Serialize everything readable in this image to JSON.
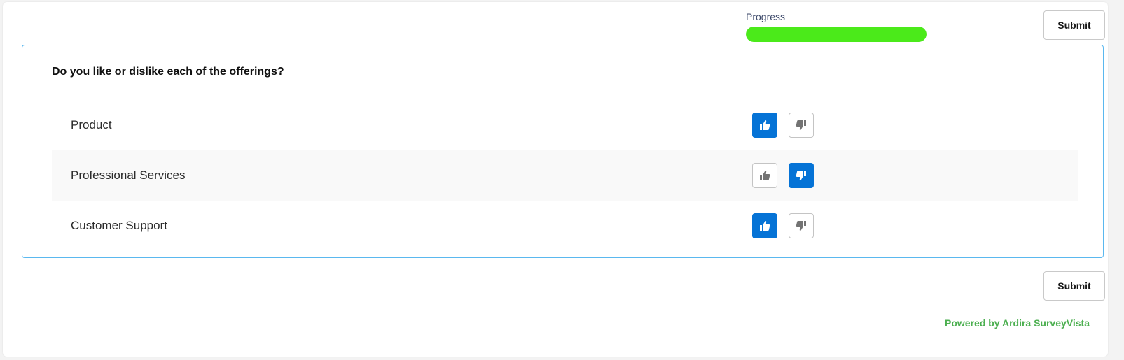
{
  "header": {
    "progress_label": "Progress",
    "progress_fraction": 1.0,
    "progress_color": "#4bea1a",
    "submit_label": "Submit"
  },
  "question": {
    "title": "Do you like or dislike each of the offerings?",
    "rows": [
      {
        "label": "Product",
        "selection": "like"
      },
      {
        "label": "Professional Services",
        "selection": "dislike"
      },
      {
        "label": "Customer Support",
        "selection": "like"
      }
    ],
    "like_icon": "thumbs-up-icon",
    "dislike_icon": "thumbs-down-icon",
    "selected_color": "#0573d6"
  },
  "footer": {
    "submit_label": "Submit",
    "powered_by": "Powered by Ardira SurveyVista",
    "powered_color": "#4caf50"
  }
}
